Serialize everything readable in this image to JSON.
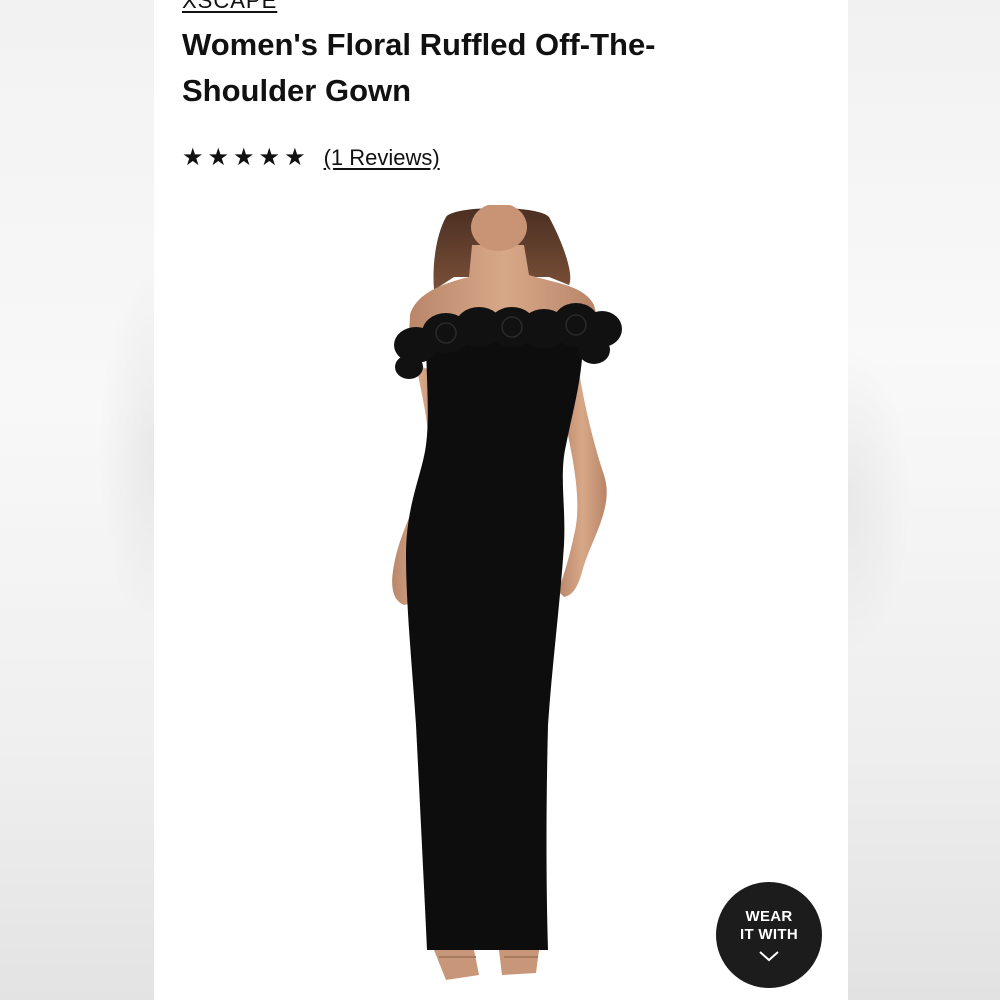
{
  "product": {
    "brand": "XSCAPE",
    "title": "Women's Floral Ruffled Off-The-Shoulder Gown",
    "rating": {
      "stars": 5,
      "reviews_label": "(1 Reviews)"
    },
    "image_alt_icon": "gown-product-image"
  },
  "wear_it_with": {
    "line1": "WEAR",
    "line2": "IT WITH",
    "icon": "chevron-down-icon"
  },
  "colors": {
    "text": "#111111",
    "dress": "#0d0d0d",
    "button": "#1c1c1c"
  }
}
